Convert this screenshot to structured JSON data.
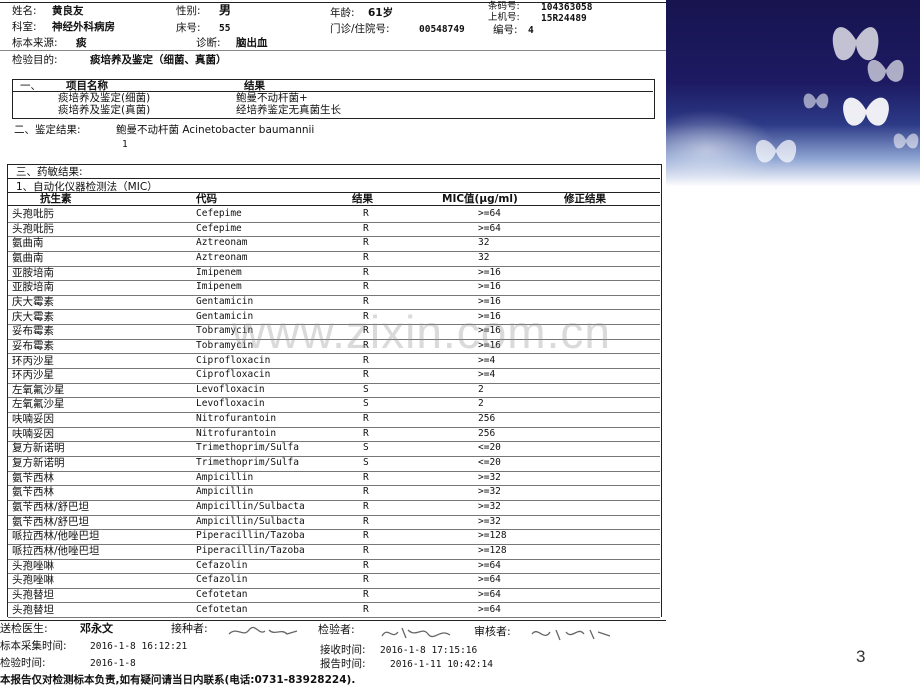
{
  "header": {
    "name_label": "姓名:",
    "name": "黄良友",
    "sex_label": "性别:",
    "sex": "男",
    "age_label": "年龄:",
    "age": "61岁",
    "barcode_label": "条码号:",
    "barcode": "104363058",
    "dept_label": "科室:",
    "dept": "神经外科病房",
    "bed_label": "床号:",
    "bed": "55",
    "clinic_label": "门诊/住院号:",
    "clinic": "00548749",
    "machine_label": "上机号:",
    "machine": "15R24489",
    "number_label": "编号:",
    "number": "4",
    "specimen_label": "标本来源:",
    "specimen": "痰",
    "diagnosis_label": "诊断:",
    "diagnosis": "脑出血",
    "purpose_label": "检验目的:",
    "purpose": "痰培养及鉴定（细菌、真菌）"
  },
  "section1": {
    "num": "一、",
    "col_item": "项目名称",
    "col_result": "结果",
    "rows": [
      {
        "item": "痰培养及鉴定(细菌)",
        "result": "鲍曼不动杆菌+"
      },
      {
        "item": "痰培养及鉴定(真菌)",
        "result": "经培养鉴定无真菌生长"
      }
    ]
  },
  "section2": {
    "label": "二、鉴定结果:",
    "result": "鲍曼不动杆菌 Acinetobacter baumannii",
    "index": "1"
  },
  "section3": {
    "title": "三、药敏结果:",
    "subtitle": "1、自动化仪器检测法（MIC）",
    "headers": {
      "name": "抗生素",
      "code": "代码",
      "result": "结果",
      "mic": "MIC值(μg/ml)",
      "corrected": "修正结果"
    },
    "rows": [
      {
        "name": "头孢吡肟",
        "code": "Cefepime",
        "result": "R",
        "mic": ">=64"
      },
      {
        "name": "头孢吡肟",
        "code": "Cefepime",
        "result": "R",
        "mic": ">=64"
      },
      {
        "name": "氨曲南",
        "code": "Aztreonam",
        "result": "R",
        "mic": "32"
      },
      {
        "name": "氨曲南",
        "code": "Aztreonam",
        "result": "R",
        "mic": "32"
      },
      {
        "name": "亚胺培南",
        "code": "Imipenem",
        "result": "R",
        "mic": ">=16"
      },
      {
        "name": "亚胺培南",
        "code": "Imipenem",
        "result": "R",
        "mic": ">=16"
      },
      {
        "name": "庆大霉素",
        "code": "Gentamicin",
        "result": "R",
        "mic": ">=16"
      },
      {
        "name": "庆大霉素",
        "code": "Gentamicin",
        "result": "R",
        "mic": ">=16"
      },
      {
        "name": "妥布霉素",
        "code": "Tobramycin",
        "result": "R",
        "mic": ">=16"
      },
      {
        "name": "妥布霉素",
        "code": "Tobramycin",
        "result": "R",
        "mic": ">=16"
      },
      {
        "name": "环丙沙星",
        "code": "Ciprofloxacin",
        "result": "R",
        "mic": ">=4"
      },
      {
        "name": "环丙沙星",
        "code": "Ciprofloxacin",
        "result": "R",
        "mic": ">=4"
      },
      {
        "name": "左氧氟沙星",
        "code": "Levofloxacin",
        "result": "S",
        "mic": "2"
      },
      {
        "name": "左氧氟沙星",
        "code": "Levofloxacin",
        "result": "S",
        "mic": "2"
      },
      {
        "name": "呋喃妥因",
        "code": "Nitrofurantoin",
        "result": "R",
        "mic": "256"
      },
      {
        "name": "呋喃妥因",
        "code": "Nitrofurantoin",
        "result": "R",
        "mic": "256"
      },
      {
        "name": "复方新诺明",
        "code": "Trimethoprim/Sulfa",
        "result": "S",
        "mic": "<=20"
      },
      {
        "name": "复方新诺明",
        "code": "Trimethoprim/Sulfa",
        "result": "S",
        "mic": "<=20"
      },
      {
        "name": "氨苄西林",
        "code": "Ampicillin",
        "result": "R",
        "mic": ">=32"
      },
      {
        "name": "氨苄西林",
        "code": "Ampicillin",
        "result": "R",
        "mic": ">=32"
      },
      {
        "name": "氨苄西林/舒巴坦",
        "code": "Ampicillin/Sulbacta",
        "result": "R",
        "mic": ">=32"
      },
      {
        "name": "氨苄西林/舒巴坦",
        "code": "Ampicillin/Sulbacta",
        "result": "R",
        "mic": ">=32"
      },
      {
        "name": "哌拉西林/他唑巴坦",
        "code": "Piperacillin/Tazoba",
        "result": "R",
        "mic": ">=128"
      },
      {
        "name": "哌拉西林/他唑巴坦",
        "code": "Piperacillin/Tazoba",
        "result": "R",
        "mic": ">=128"
      },
      {
        "name": "头孢唑啉",
        "code": "Cefazolin",
        "result": "R",
        "mic": ">=64"
      },
      {
        "name": "头孢唑啉",
        "code": "Cefazolin",
        "result": "R",
        "mic": ">=64"
      },
      {
        "name": "头孢替坦",
        "code": "Cefotetan",
        "result": "R",
        "mic": ">=64"
      },
      {
        "name": "头孢替坦",
        "code": "Cefotetan",
        "result": "R",
        "mic": ">=64"
      }
    ]
  },
  "footer": {
    "doctor_label": "送检医生:",
    "doctor": "邓永文",
    "receiver_label": "接种者:",
    "tester_label": "检验者:",
    "reviewer_label": "审核者:",
    "sample_time_label": "标本采集时间:",
    "sample_time": "2016-1-8 16:12:21",
    "receive_time_label": "接收时间:",
    "receive_time": "2016-1-8 17:15:16",
    "test_time_label": "检验时间:",
    "test_time": "2016-1-8",
    "report_time_label": "报告时间:",
    "report_time": "2016-1-11 10:42:14",
    "disclaimer": "本报告仅对检测标本负责,如有疑问请当日内联系(电话:0731-83928224)."
  },
  "watermark": "www.zixin.com.cn",
  "page_number": "3",
  "colors": {
    "deco_dark": "#17144f",
    "deco_mid": "#2c3a86",
    "butterfly": "#ffffff"
  }
}
